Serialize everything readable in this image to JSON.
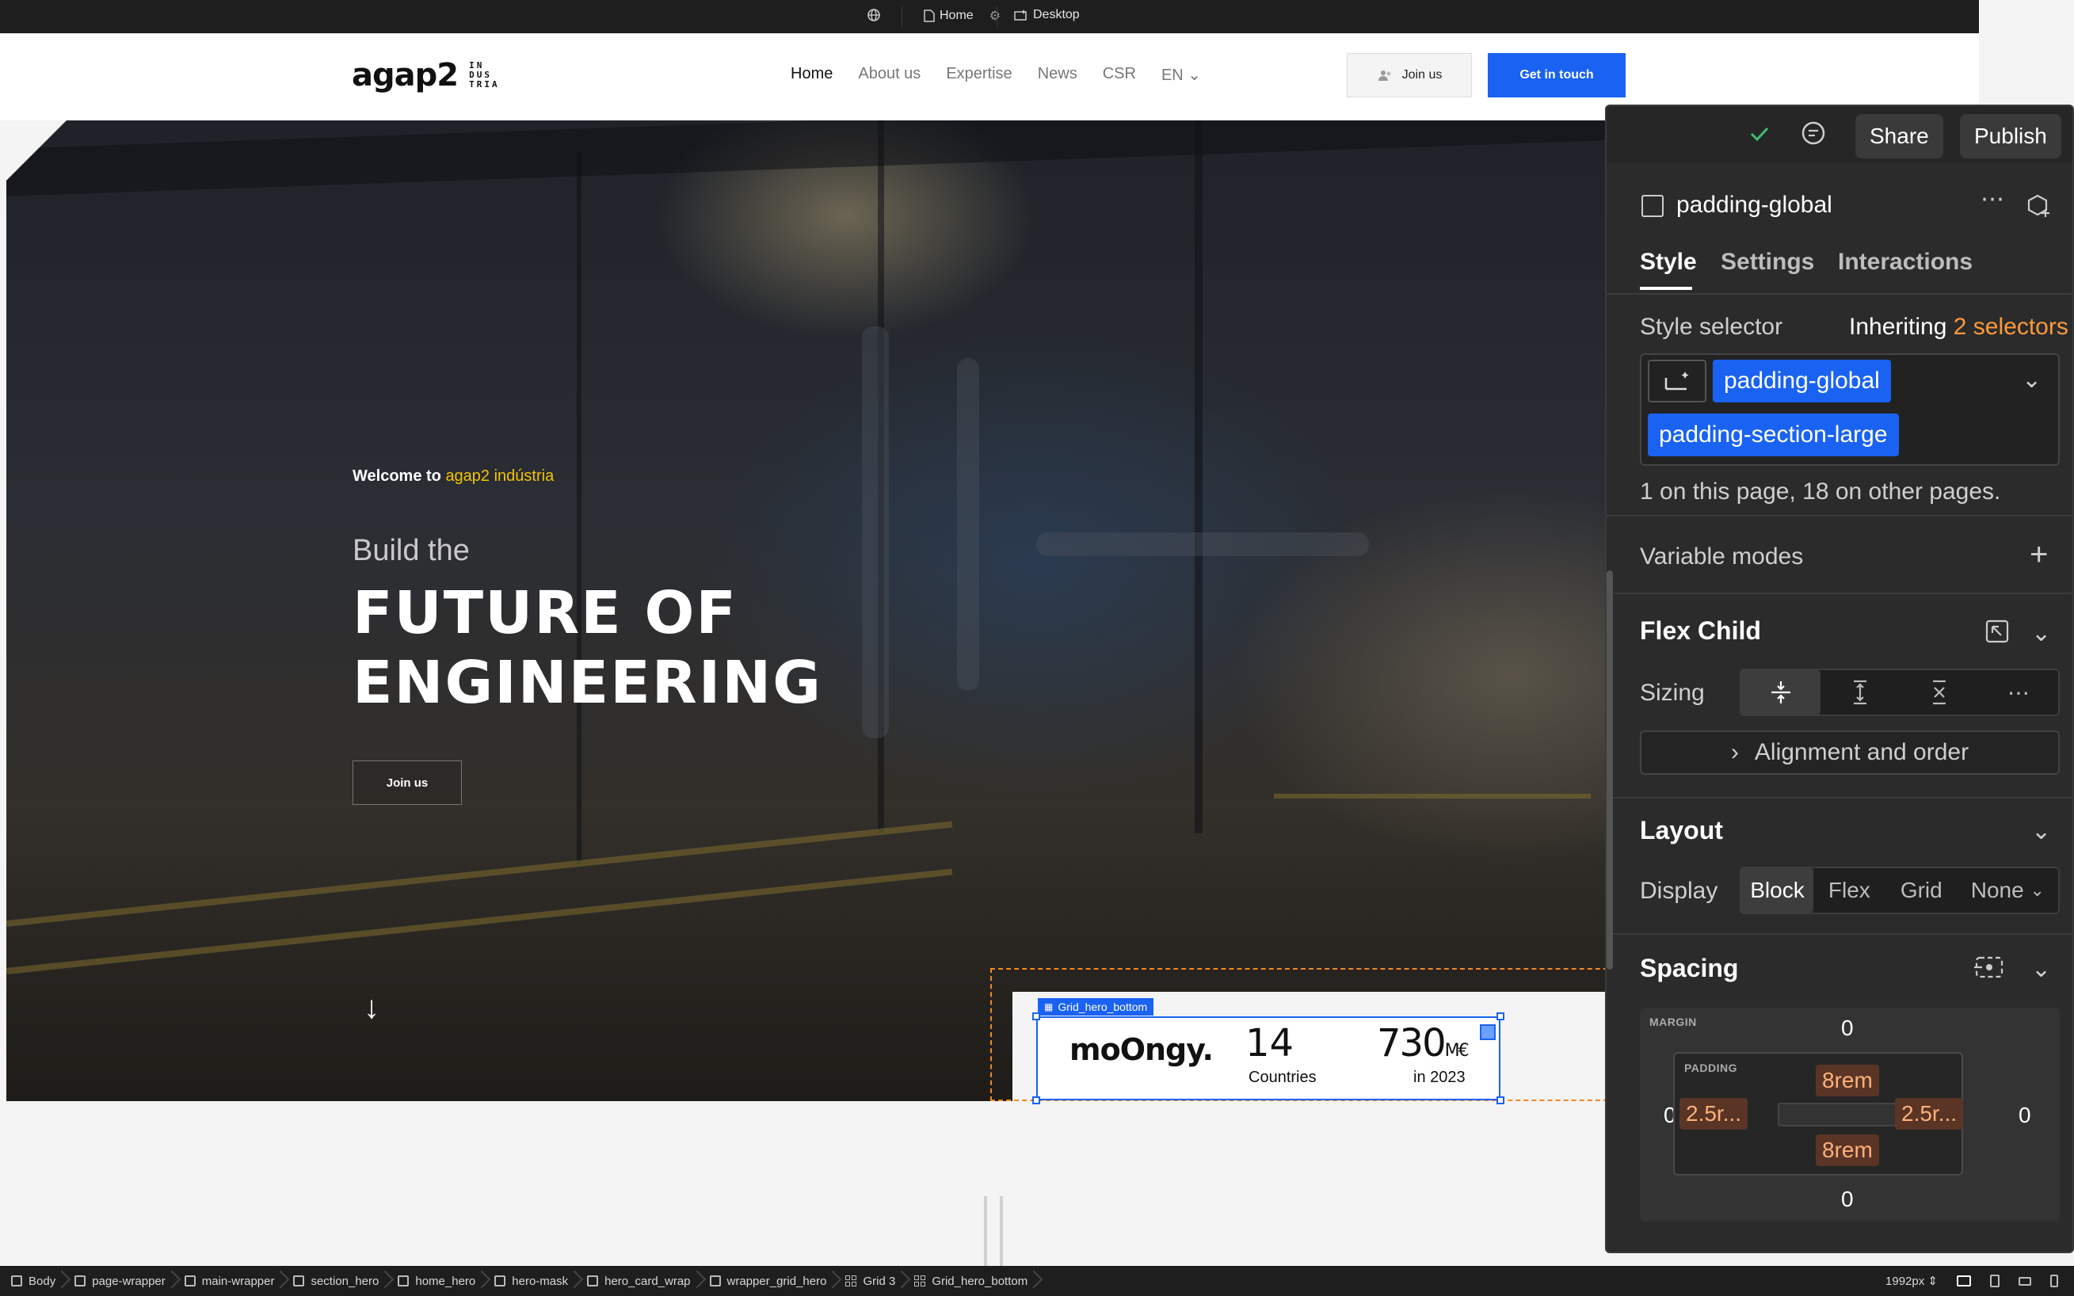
{
  "topbar": {
    "page_label": "Home",
    "breakpoint_label": "Desktop"
  },
  "site": {
    "logo": "agap2",
    "logo_sub": [
      "IN",
      "DUS",
      "TRIA"
    ],
    "nav": [
      "Home",
      "About us",
      "Expertise",
      "News",
      "CSR",
      "EN"
    ],
    "join_label": "Join us",
    "cta_label": "Get in touch",
    "hero": {
      "welcome": "Welcome to",
      "welcome_highlight": "agap2 indústria",
      "build": "Build the",
      "title_line1": "FUTURE OF",
      "title_line2": "ENGINEERING",
      "join_label": "Join us",
      "arrow": "↓"
    },
    "stats": {
      "tag": "Grid_hero_bottom",
      "brand": "moOngy.",
      "items": [
        {
          "value": "14",
          "label": "Countries"
        },
        {
          "value": "730",
          "suffix": "M€",
          "label": "in 2023"
        }
      ]
    }
  },
  "panel": {
    "share_label": "Share",
    "publish_label": "Publish",
    "element_name": "padding-global",
    "tabs": [
      "Style",
      "Settings",
      "Interactions"
    ],
    "style_selector_label": "Style selector",
    "inheriting_label": "Inheriting",
    "inheriting_link": "2 selectors",
    "selectors": [
      "padding-global",
      "padding-section-large"
    ],
    "usage_note": "1 on this page, 18 on other pages.",
    "variable_modes_label": "Variable modes",
    "flex_child_label": "Flex Child",
    "sizing_label": "Sizing",
    "alignment_label": "Alignment and order",
    "layout_label": "Layout",
    "display_label": "Display",
    "display_options": [
      "Block",
      "Flex",
      "Grid",
      "None"
    ],
    "spacing_label": "Spacing",
    "margin_label": "MARGIN",
    "padding_label": "PADDING",
    "margin": {
      "top": "0",
      "right": "0",
      "bottom": "0",
      "left": "0"
    },
    "padding": {
      "top": "8rem",
      "right": "2.5r...",
      "bottom": "8rem",
      "left": "2.5r..."
    }
  },
  "breadcrumbs": [
    "Body",
    "page-wrapper",
    "main-wrapper",
    "section_hero",
    "home_hero",
    "hero-mask",
    "hero_card_wrap",
    "wrapper_grid_hero",
    "Grid 3",
    "Grid_hero_bottom"
  ],
  "bottombar": {
    "width_readout": "1992px"
  },
  "colors": {
    "accent_blue": "#1a62f2",
    "highlight_yellow": "#f5c400",
    "padding_orange": "#ffb07a",
    "selection_dash": "#f08a24"
  }
}
